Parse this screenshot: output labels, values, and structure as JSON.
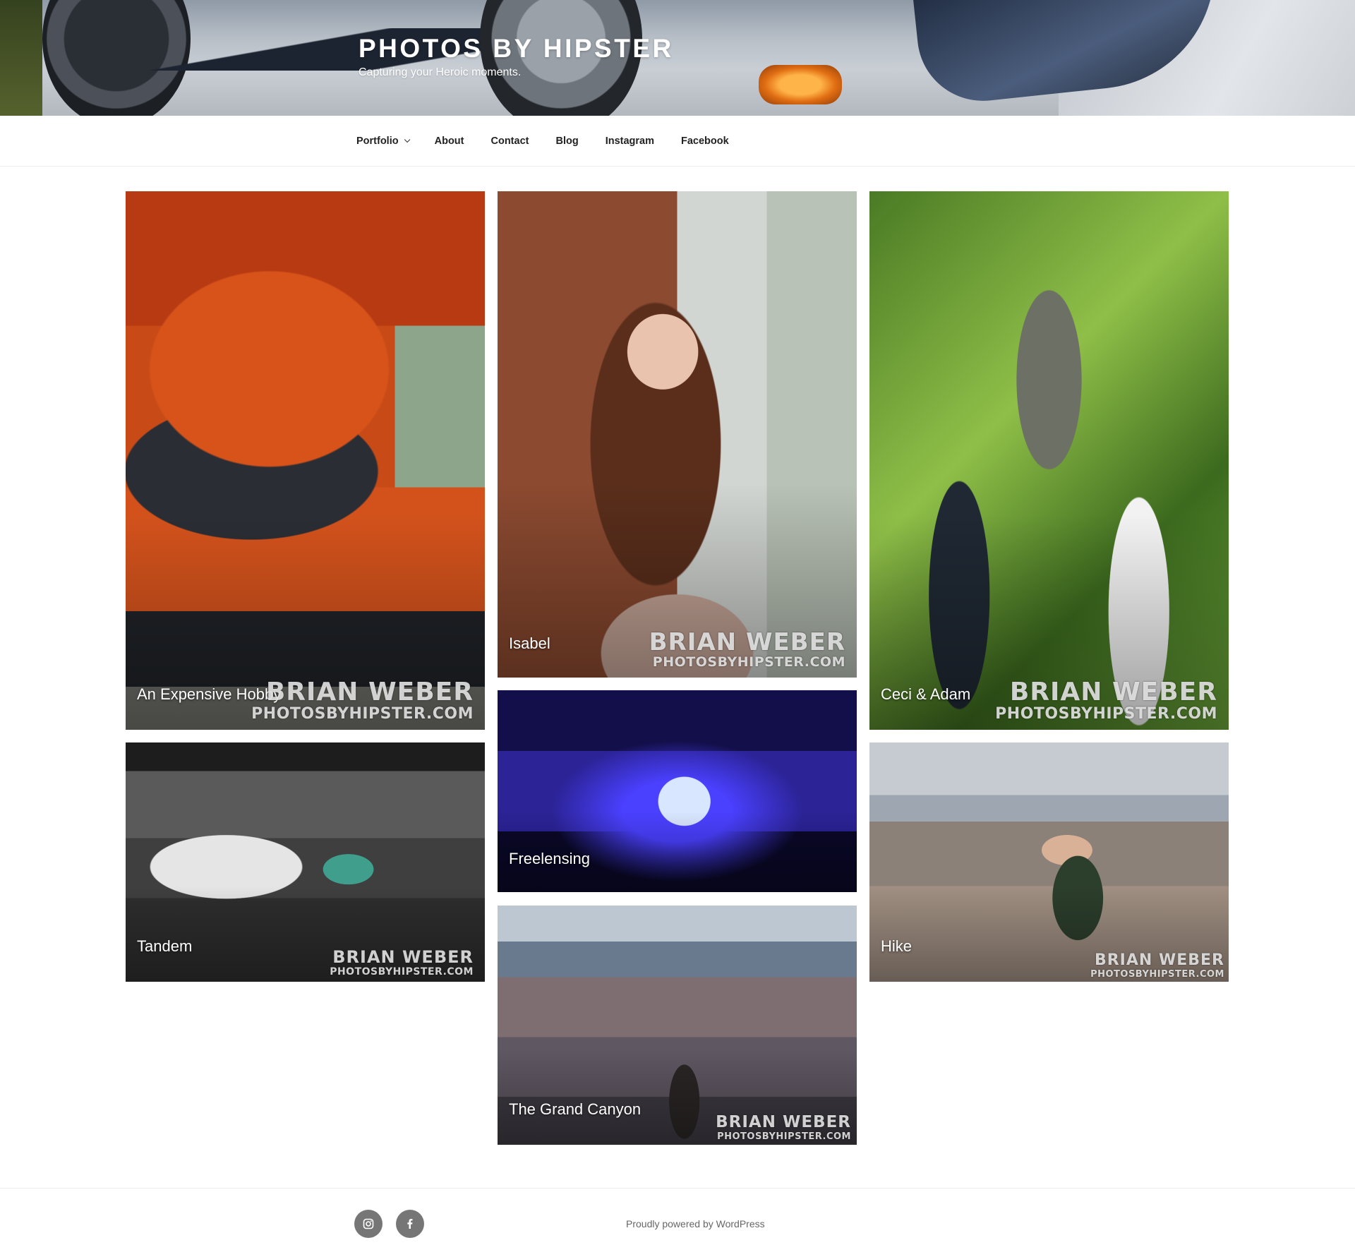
{
  "site": {
    "title": "PHOTOS BY HIPSTER",
    "tagline": "Capturing your Heroic moments."
  },
  "nav": {
    "items": [
      "Portfolio",
      "About",
      "Contact",
      "Blog",
      "Instagram",
      "Facebook"
    ]
  },
  "gallery": {
    "watermark_name": "BRIAN WEBER",
    "watermark_site": "PHOTOSBYHIPSTER.COM",
    "items": [
      {
        "title": "An Expensive Hobby"
      },
      {
        "title": "Isabel"
      },
      {
        "title": "Ceci & Adam"
      },
      {
        "title": "Tandem"
      },
      {
        "title": "Freelensing"
      },
      {
        "title": "Hike"
      },
      {
        "title": "The Grand Canyon"
      }
    ]
  },
  "footer": {
    "social": [
      "instagram-icon",
      "facebook-icon"
    ],
    "powered_by": "Proudly powered by WordPress"
  }
}
